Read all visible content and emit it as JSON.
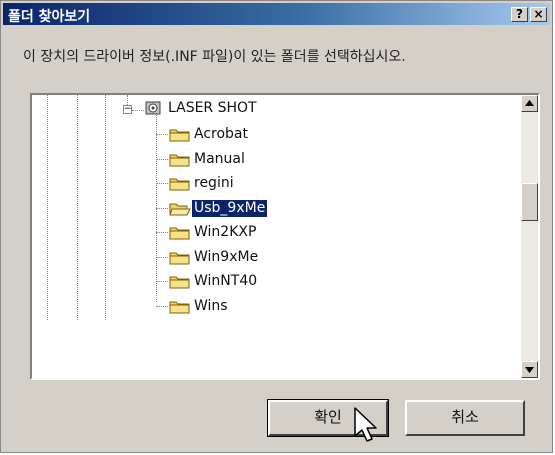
{
  "window": {
    "title": "폴더 찾아보기",
    "help_label": "?",
    "close_label": "×"
  },
  "prompt": "이 장치의 드라이버 정보(.INF 파일)이 있는 폴더를 선택하십시오.",
  "tree": {
    "root": {
      "label": "LASER SHOT",
      "icon": "drive-icon",
      "expanded": true
    },
    "folders": [
      {
        "label": "Acrobat",
        "selected": false
      },
      {
        "label": "Manual",
        "selected": false
      },
      {
        "label": "regini",
        "selected": false
      },
      {
        "label": "Usb_9xMe",
        "selected": true
      },
      {
        "label": "Win2KXP",
        "selected": false
      },
      {
        "label": "Win9xMe",
        "selected": false
      },
      {
        "label": "WinNT40",
        "selected": false
      },
      {
        "label": "Wins",
        "selected": false
      }
    ]
  },
  "buttons": {
    "ok_label": "확인",
    "cancel_label": "취소"
  },
  "colors": {
    "title_gradient_start": "#0a246a",
    "selection": "#0a246a",
    "face": "#d4d0c8"
  }
}
